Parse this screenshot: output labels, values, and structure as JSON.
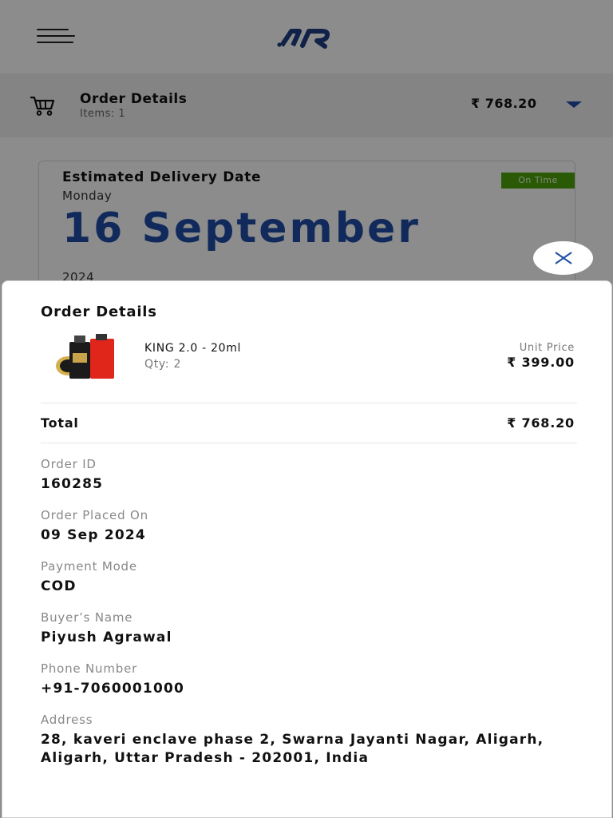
{
  "header": {
    "menu_icon": "hamburger-menu-icon",
    "logo_icon": "brand-logo-icon"
  },
  "order_bar": {
    "title": "Order Details",
    "items": "Items: 1",
    "price": "₹ 768.20",
    "cart_icon": "cart-icon",
    "caret_icon": "caret-down-icon"
  },
  "delivery": {
    "title": "Estimated Delivery Date",
    "day": "Monday",
    "date": "16 September",
    "year": "2024",
    "badge": "On Time"
  },
  "modal": {
    "title": "Order Details",
    "close_icon": "close-icon",
    "product": {
      "name": "KING 2.0 - 20ml",
      "qty": "Qty: 2",
      "unit_price_label": "Unit Price",
      "unit_price": "₹ 399.00"
    },
    "total_label": "Total",
    "total_value": "₹ 768.20",
    "fields": {
      "order_id_label": "Order ID",
      "order_id": "160285",
      "placed_label": "Order Placed On",
      "placed": "09 Sep 2024",
      "payment_label": "Payment Mode",
      "payment": "COD",
      "buyer_label": "Buyer’s Name",
      "buyer": "Piyush Agrawal",
      "phone_label": "Phone Number",
      "phone": "+91-7060001000",
      "address_label": "Address",
      "address": "28, kaveri enclave phase 2, Swarna Jayanti Nagar, Aligarh, Aligarh, Uttar Pradesh - 202001, India"
    }
  },
  "colors": {
    "accent": "#1f4ea6",
    "badge": "#4ea50a"
  }
}
